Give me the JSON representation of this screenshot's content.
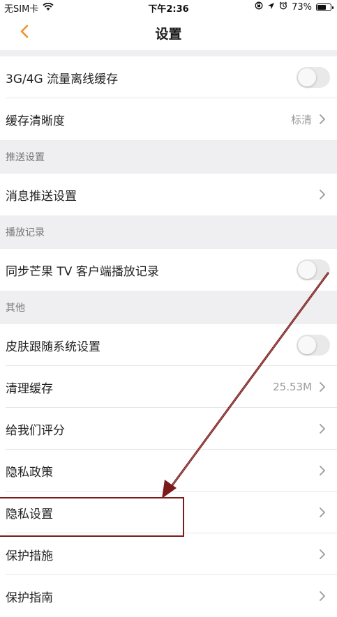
{
  "status_bar": {
    "carrier": "无SIM卡",
    "time": "下午2:36",
    "battery_percent": "73%",
    "battery_level": 0.73,
    "icons": [
      "wifi-icon",
      "orientation-lock-icon",
      "location-icon",
      "alarm-icon",
      "battery-icon"
    ]
  },
  "nav": {
    "title": "设置",
    "back_icon": "chevron-left-icon",
    "accent_color": "#f0922b"
  },
  "settings": {
    "offline_cache_label": "3G/4G 流量离线缓存",
    "offline_cache_on": false,
    "cache_quality_label": "缓存清晰度",
    "cache_quality_value": "标清",
    "push_section": "推送设置",
    "push_label": "消息推送设置",
    "history_section": "播放记录",
    "sync_history_label": "同步芒果 TV 客户端播放记录",
    "sync_history_on": false,
    "other_section": "其他",
    "skin_follow_label": "皮肤跟随系统设置",
    "skin_follow_on": false,
    "clear_cache_label": "清理缓存",
    "clear_cache_value": "25.53M",
    "rate_label": "给我们评分",
    "privacy_policy_label": "隐私政策",
    "privacy_settings_label": "隐私设置",
    "protection_label": "保护措施",
    "guide_label": "保护指南"
  },
  "annotation": {
    "highlight_color": "#7a1a1a"
  }
}
